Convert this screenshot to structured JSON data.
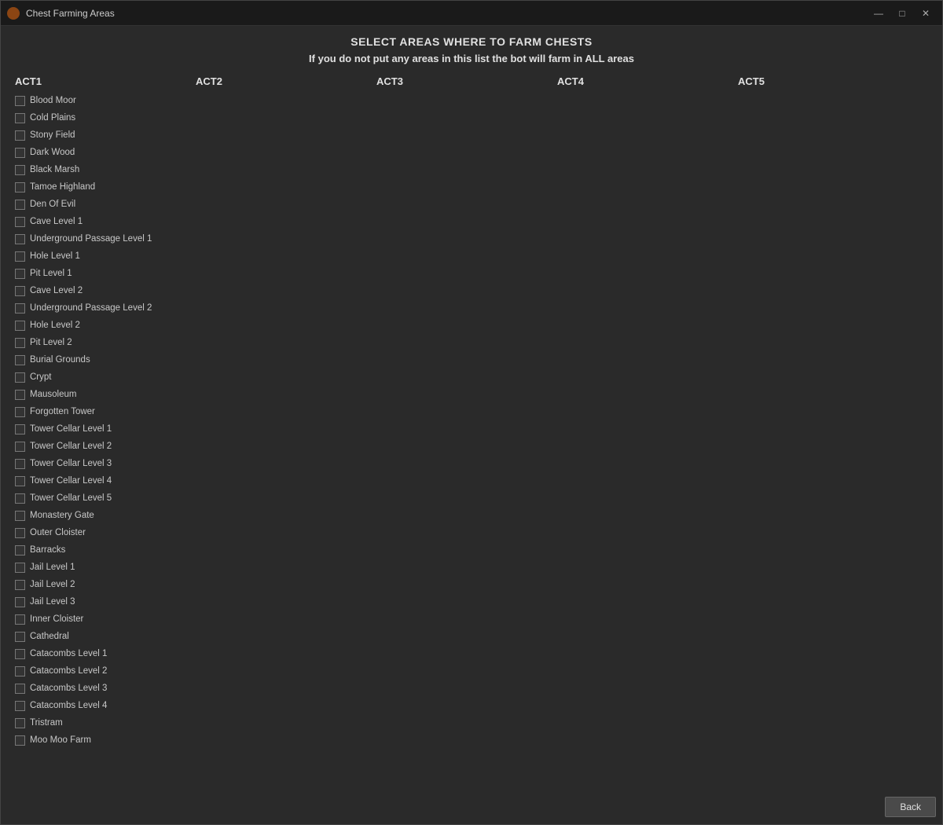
{
  "window": {
    "title": "Chest Farming Areas",
    "controls": {
      "minimize": "—",
      "maximize": "□",
      "close": "✕"
    }
  },
  "header": {
    "title": "SELECT AREAS WHERE TO FARM CHESTS",
    "subtitle": "If you do not put any areas in this list the bot will farm in ALL areas"
  },
  "columns": [
    {
      "label": "ACT1"
    },
    {
      "label": "ACT2"
    },
    {
      "label": "ACT3"
    },
    {
      "label": "ACT4"
    },
    {
      "label": "ACT5"
    }
  ],
  "act1": [
    "Blood Moor",
    "Cold Plains",
    "Stony Field",
    "Dark Wood",
    "Black Marsh",
    "Tamoe Highland",
    "Den Of Evil",
    "Cave Level 1",
    "Underground Passage Level 1",
    "Hole Level 1",
    "Pit Level 1",
    "Cave Level 2",
    "Underground Passage Level 2",
    "Hole Level 2",
    "Pit Level 2",
    "Burial Grounds",
    "Crypt",
    "Mausoleum",
    "Forgotten Tower",
    "Tower Cellar Level 1",
    "Tower Cellar Level 2",
    "Tower Cellar Level 3",
    "Tower Cellar Level 4",
    "Tower Cellar Level 5",
    "Monastery Gate",
    "Outer Cloister",
    "Barracks",
    "Jail Level 1",
    "Jail Level 2",
    "Jail Level 3",
    "Inner Cloister",
    "Cathedral",
    "Catacombs Level 1",
    "Catacombs Level 2",
    "Catacombs Level 3",
    "Catacombs Level 4",
    "Tristram",
    "Moo Moo Farm"
  ],
  "act2": [],
  "act3": [],
  "act4": [],
  "act5": [],
  "footer": {
    "back_label": "Back"
  }
}
